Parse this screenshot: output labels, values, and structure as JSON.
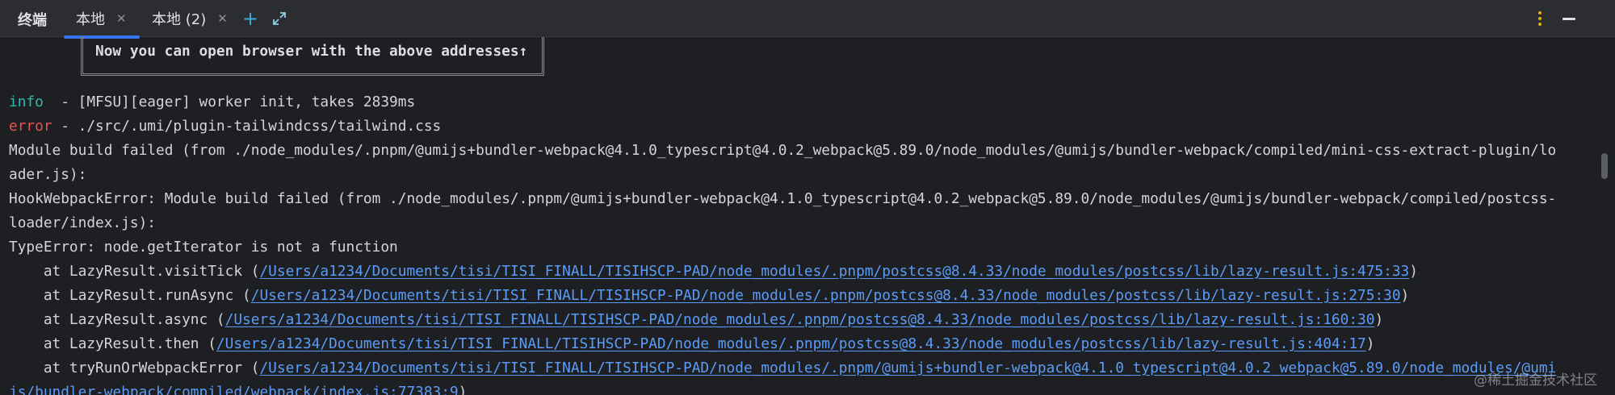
{
  "panel": {
    "title": "终端"
  },
  "tabs": [
    {
      "label": "本地",
      "active": true
    },
    {
      "label": "本地 (2)",
      "active": false
    }
  ],
  "icons": {
    "close": "close-icon",
    "add": "plus-icon",
    "expand": "expand-icon",
    "more": "kebab-icon",
    "minimize": "minimize-icon"
  },
  "colors": {
    "accent": "#3574f0",
    "info": "#2fb9b0",
    "error": "#f0524f",
    "link": "#5a9cf8"
  },
  "terminal": {
    "address_notice": "Now you can open browser with the above addresses↑",
    "info_level": "info",
    "info_text": "  - [MFSU][eager] worker init, takes 2839ms",
    "error_level": "error",
    "error_text": " - ./src/.umi/plugin-tailwindcss/tailwind.css",
    "lines": [
      "Module build failed (from ./node_modules/.pnpm/@umijs+bundler-webpack@4.1.0_typescript@4.0.2_webpack@5.89.0/node_modules/@umijs/bundler-webpack/compiled/mini-css-extract-plugin/lo",
      "ader.js):",
      "HookWebpackError: Module build failed (from ./node_modules/.pnpm/@umijs+bundler-webpack@4.1.0_typescript@4.0.2_webpack@5.89.0/node_modules/@umijs/bundler-webpack/compiled/postcss-",
      "loader/index.js):",
      "TypeError: node.getIterator is not a function"
    ],
    "stack": [
      {
        "prefix": "    at LazyResult.visitTick (",
        "link": "/Users/a1234/Documents/tisi/TISI_FINALL/TISIHSCP-PAD/node_modules/.pnpm/postcss@8.4.33/node_modules/postcss/lib/lazy-result.js:475:33",
        "suffix": ")"
      },
      {
        "prefix": "    at LazyResult.runAsync (",
        "link": "/Users/a1234/Documents/tisi/TISI_FINALL/TISIHSCP-PAD/node_modules/.pnpm/postcss@8.4.33/node_modules/postcss/lib/lazy-result.js:275:30",
        "suffix": ")"
      },
      {
        "prefix": "    at LazyResult.async (",
        "link": "/Users/a1234/Documents/tisi/TISI_FINALL/TISIHSCP-PAD/node_modules/.pnpm/postcss@8.4.33/node_modules/postcss/lib/lazy-result.js:160:30",
        "suffix": ")"
      },
      {
        "prefix": "    at LazyResult.then (",
        "link": "/Users/a1234/Documents/tisi/TISI_FINALL/TISIHSCP-PAD/node_modules/.pnpm/postcss@8.4.33/node_modules/postcss/lib/lazy-result.js:404:17",
        "suffix": ")"
      },
      {
        "prefix": "    at tryRunOrWebpackError (",
        "link": "/Users/a1234/Documents/tisi/TISI_FINALL/TISIHSCP-PAD/node_modules/.pnpm/@umijs+bundler-webpack@4.1.0_typescript@4.0.2_webpack@5.89.0/node_modules/@umi",
        "suffix": ""
      }
    ],
    "wrap_link": "js/bundler-webpack/compiled/webpack/index.js:77383:9",
    "wrap_suffix": ")"
  },
  "watermark": "@稀土掘金技术社区"
}
